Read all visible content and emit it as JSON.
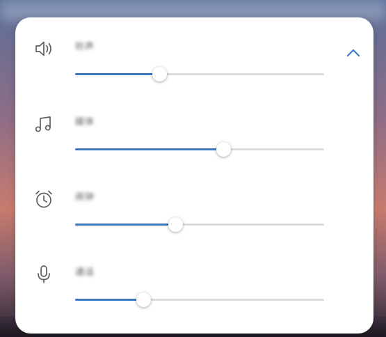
{
  "panel": {
    "collapse_icon": "chevron-up-icon",
    "accent_color": "#3d78c3",
    "track_color": "#dcdcdc"
  },
  "rows": [
    {
      "id": "speaker",
      "icon": "speaker-icon",
      "label": "铃声",
      "level": 0.34
    },
    {
      "id": "media",
      "icon": "music-note-icon",
      "label": "媒体",
      "level": 0.597
    },
    {
      "id": "alarm",
      "icon": "alarm-clock-icon",
      "label": "闹钟",
      "level": 0.404
    },
    {
      "id": "call",
      "icon": "microphone-icon",
      "label": "通话",
      "level": 0.276
    }
  ]
}
